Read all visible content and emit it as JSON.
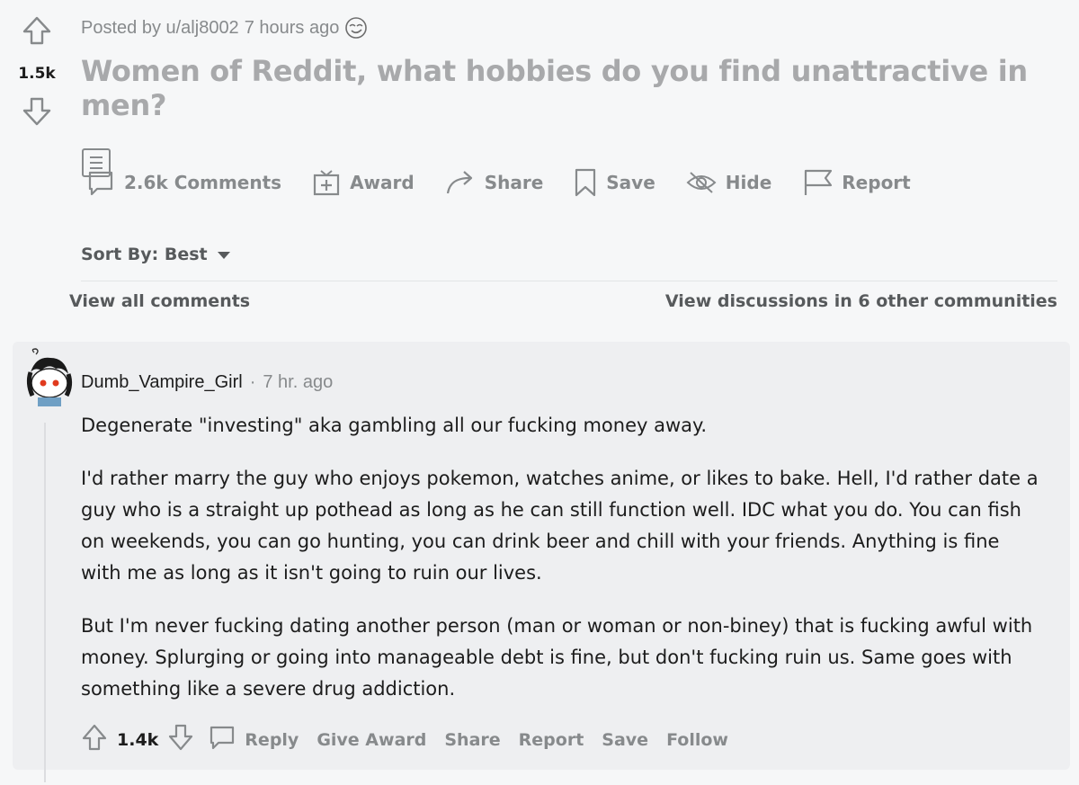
{
  "post": {
    "score": "1.5k",
    "posted_by": "Posted by u/alj8002",
    "time": "7 hours ago",
    "title": "Women of Reddit, what hobbies do you find unattractive in men?",
    "actions": {
      "comments": "2.6k Comments",
      "award": "Award",
      "share": "Share",
      "save": "Save",
      "hide": "Hide",
      "report": "Report"
    }
  },
  "sort": {
    "label": "Sort By: Best"
  },
  "links": {
    "view_all": "View all comments",
    "view_discussions": "View discussions in 6 other communities"
  },
  "comment": {
    "author": "Dumb_Vampire_Girl",
    "separator": "·",
    "time": "7 hr. ago",
    "paragraphs": [
      "Degenerate \"investing\" aka gambling all our fucking money away.",
      "I'd rather marry the guy who enjoys pokemon, watches anime, or likes to bake. Hell, I'd rather date a guy who is a straight up pothead as long as he can still function well. IDC what you do. You can fish on weekends, you can go hunting, you can drink beer and chill with your friends. Anything is fine with me as long as it isn't going to ruin our lives.",
      "But I'm never fucking dating another person (man or woman or non-biney) that is fucking awful with money. Splurging or going into manageable debt is fine, but don't fucking ruin us. Same goes with something like a severe drug addiction."
    ],
    "score": "1.4k",
    "actions": {
      "reply": "Reply",
      "give_award": "Give Award",
      "share": "Share",
      "report": "Report",
      "save": "Save",
      "follow": "Follow"
    }
  },
  "icons": {
    "upvote": "upvote-arrow-icon",
    "downvote": "downvote-arrow-icon",
    "comment": "speech-bubble-icon",
    "award": "gift-icon",
    "share": "share-arrow-icon",
    "save": "bookmark-icon",
    "hide": "eye-slash-icon",
    "report": "flag-icon",
    "sort": "caret-down-icon",
    "text_post": "text-document-icon"
  },
  "colors": {
    "background": "#f6f7f8",
    "muted": "#878a8c",
    "title": "#a8a9ab",
    "comment_bg": "#eeeff1"
  }
}
